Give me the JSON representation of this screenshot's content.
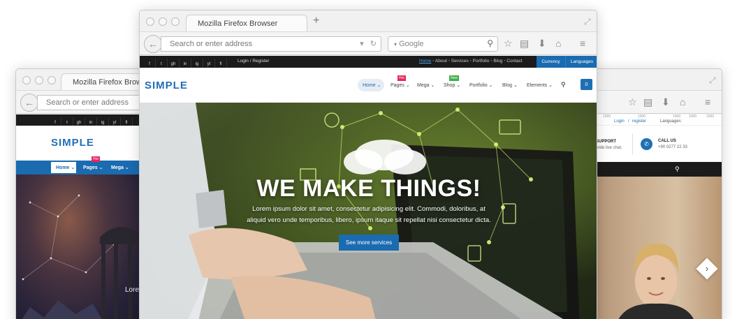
{
  "browser": {
    "tab_title": "Mozilla Firefox Browser",
    "new_tab": "+",
    "url_placeholder": "Search or enter address",
    "search_placeholder": "Google",
    "back": "←",
    "reload": "↻",
    "dropdown": "▾",
    "expand": "⤢"
  },
  "social_icons": [
    "f",
    "t",
    "gh",
    "in",
    "ig",
    "yt",
    "fl"
  ],
  "site": {
    "brand": "SIMPLE",
    "login": "Login",
    "login_sep": "/",
    "register": "Register",
    "top_links": [
      "Home",
      "About",
      "Services",
      "Portfolio",
      "Blog",
      "Contact"
    ],
    "currency": "Currency",
    "languages": "Languages",
    "menu": [
      {
        "label": "Home",
        "caret": "⌄"
      },
      {
        "label": "Pages",
        "caret": "⌄",
        "badge": "Hot"
      },
      {
        "label": "Mega",
        "caret": "⌄"
      },
      {
        "label": "Shop",
        "caret": "⌄",
        "badge": "New"
      },
      {
        "label": "Portfolio",
        "caret": "⌄"
      },
      {
        "label": "Blog",
        "caret": "⌄"
      },
      {
        "label": "Elements",
        "caret": "⌄"
      }
    ],
    "cart_count": "0"
  },
  "hero": {
    "headline": "WE MAKE THINGS!",
    "line1": "Lorem ipsum dolor sit amet, consectetur adipisicing elit. Commodi, doloribus, at",
    "line2": "aliquid vero unde temporibus, libero, ipsum itaque sit repellat nisi consectetur dicta.",
    "cta": "See more services"
  },
  "left_window": {
    "menu": [
      "Home",
      "Pages",
      "Mega"
    ],
    "badge": "Hot",
    "partial_text": "Lore"
  },
  "right_window": {
    "login": "Login",
    "sep": "/",
    "register": "register",
    "languages": "Languages",
    "support_title": "SUPPORT",
    "support_text": "wide live chat.",
    "call_title": "CALL US",
    "call_number": "+90 0277 22 33",
    "ruler_marks": [
      "1000",
      "1000",
      "1000",
      "1000",
      "1000"
    ],
    "slider_next": "›"
  },
  "colors": {
    "brand_blue": "#1f6fb5",
    "nav_blue": "#1a6bb0",
    "hot_badge": "#e8245c",
    "new_badge": "#3cae4a",
    "topbar": "#1b1b1b"
  }
}
